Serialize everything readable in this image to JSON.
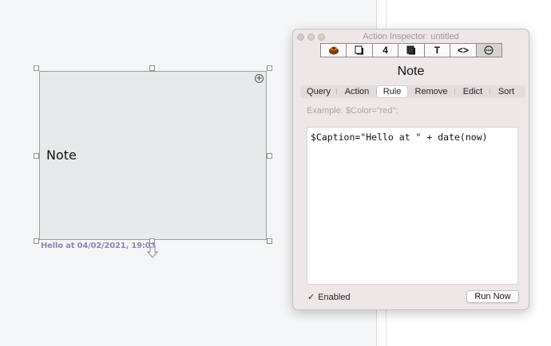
{
  "canvas": {
    "note": {
      "title": "Note",
      "caption": "Hello at 04/02/2021, 19:03"
    }
  },
  "inspector": {
    "window_title": "Action Inspector: untitled",
    "toolbar": [
      "",
      "",
      "4",
      "",
      "T",
      "<>",
      "⊙"
    ],
    "heading": "Note",
    "tabs": [
      "Query",
      "Action",
      "Rule",
      "Remove",
      "Edict",
      "Sort"
    ],
    "active_tab": "Rule",
    "example": "Example: $Color=\"red\";",
    "code": "$Caption=\"Hello at \" + date(now)",
    "enabled_label": "Enabled",
    "enabled_checked": true,
    "run_button": "Run Now"
  },
  "colors": {
    "note_fill": "#e7eaea",
    "caption_color": "#8a86b5",
    "inspector_bg": "#efe7e7"
  }
}
